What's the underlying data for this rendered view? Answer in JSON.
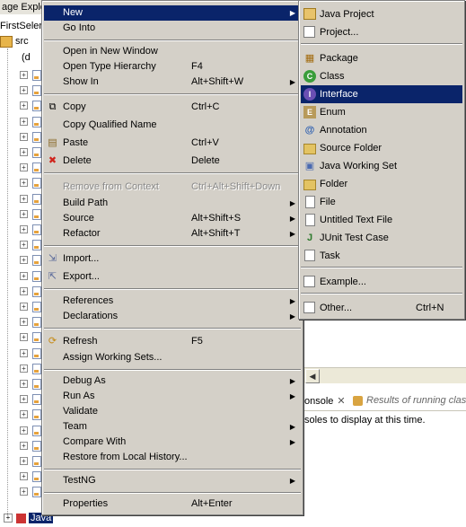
{
  "explorer": {
    "title": "age Explo",
    "project": "FirstSeler",
    "src": "src",
    "row2": "(d",
    "bottom_item": "Java"
  },
  "context_menu": {
    "new": "New",
    "go_into": "Go Into",
    "open_new_window": "Open in New Window",
    "open_type_hierarchy": "Open Type Hierarchy",
    "open_type_hierarchy_key": "F4",
    "show_in": "Show In",
    "show_in_key": "Alt+Shift+W",
    "copy": "Copy",
    "copy_key": "Ctrl+C",
    "copy_qualified": "Copy Qualified Name",
    "paste": "Paste",
    "paste_key": "Ctrl+V",
    "delete": "Delete",
    "delete_key": "Delete",
    "remove_from_context": "Remove from Context",
    "remove_from_context_key": "Ctrl+Alt+Shift+Down",
    "build_path": "Build Path",
    "source": "Source",
    "source_key": "Alt+Shift+S",
    "refactor": "Refactor",
    "refactor_key": "Alt+Shift+T",
    "import": "Import...",
    "export": "Export...",
    "references": "References",
    "declarations": "Declarations",
    "refresh": "Refresh",
    "refresh_key": "F5",
    "assign_working_sets": "Assign Working Sets...",
    "debug_as": "Debug As",
    "run_as": "Run As",
    "validate": "Validate",
    "team": "Team",
    "compare_with": "Compare With",
    "restore_local_history": "Restore from Local History...",
    "testng": "TestNG",
    "properties": "Properties",
    "properties_key": "Alt+Enter"
  },
  "submenu": {
    "java_project": "Java Project",
    "project": "Project...",
    "package": "Package",
    "class": "Class",
    "interface": "Interface",
    "enum": "Enum",
    "annotation": "Annotation",
    "source_folder": "Source Folder",
    "java_working_set": "Java Working Set",
    "folder": "Folder",
    "file": "File",
    "untitled_text_file": "Untitled Text File",
    "junit_test_case": "JUnit Test Case",
    "task": "Task",
    "example": "Example...",
    "other": "Other...",
    "other_key": "Ctrl+N"
  },
  "console": {
    "tab_label": "onsole",
    "results_tab": "Results of running clas",
    "message": "soles to display at this time."
  },
  "colors": {
    "menu_bg": "#d4d0c8",
    "highlight": "#0a246a"
  }
}
